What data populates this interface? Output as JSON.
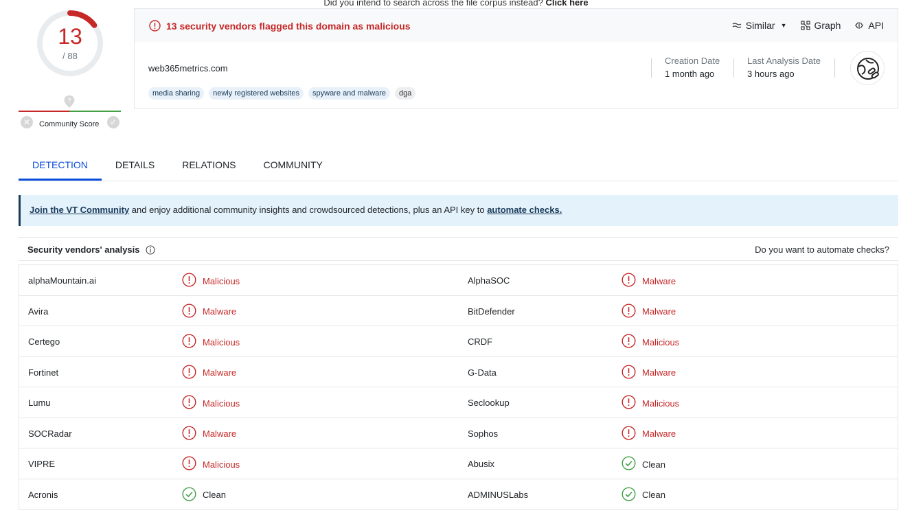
{
  "top_hint": {
    "text": "Did you intend to search across the file corpus instead?",
    "link": "Click here"
  },
  "score": {
    "detections": "13",
    "total": "/ 88",
    "fraction": 0.148,
    "color": "#c62828"
  },
  "community": {
    "label": "Community Score"
  },
  "alert": {
    "text": "13 security vendors flagged this domain as malicious"
  },
  "actions": {
    "similar": "Similar",
    "graph": "Graph",
    "api": "API"
  },
  "domain": "web365metrics.com",
  "tags": [
    "media sharing",
    "newly registered websites",
    "spyware and malware",
    "dga"
  ],
  "meta": [
    {
      "label": "Creation Date",
      "value": "1 month ago"
    },
    {
      "label": "Last Analysis Date",
      "value": "3 hours ago"
    }
  ],
  "tabs": [
    {
      "label": "DETECTION",
      "active": true
    },
    {
      "label": "DETAILS",
      "active": false
    },
    {
      "label": "RELATIONS",
      "active": false
    },
    {
      "label": "COMMUNITY",
      "active": false
    }
  ],
  "banner": {
    "link1": "Join the VT Community",
    "middle": " and enjoy additional community insights and crowdsourced detections, plus an API key to ",
    "link2": "automate checks."
  },
  "analysis": {
    "title": "Security vendors' analysis",
    "right": "Do you want to automate checks?"
  },
  "vendors": [
    [
      {
        "name": "alphaMountain.ai",
        "result": "Malicious",
        "status": "bad"
      },
      {
        "name": "AlphaSOC",
        "result": "Malware",
        "status": "bad"
      }
    ],
    [
      {
        "name": "Avira",
        "result": "Malware",
        "status": "bad"
      },
      {
        "name": "BitDefender",
        "result": "Malware",
        "status": "bad"
      }
    ],
    [
      {
        "name": "Certego",
        "result": "Malicious",
        "status": "bad"
      },
      {
        "name": "CRDF",
        "result": "Malicious",
        "status": "bad"
      }
    ],
    [
      {
        "name": "Fortinet",
        "result": "Malware",
        "status": "bad"
      },
      {
        "name": "G-Data",
        "result": "Malware",
        "status": "bad"
      }
    ],
    [
      {
        "name": "Lumu",
        "result": "Malicious",
        "status": "bad"
      },
      {
        "name": "Seclookup",
        "result": "Malicious",
        "status": "bad"
      }
    ],
    [
      {
        "name": "SOCRadar",
        "result": "Malware",
        "status": "bad"
      },
      {
        "name": "Sophos",
        "result": "Malware",
        "status": "bad"
      }
    ],
    [
      {
        "name": "VIPRE",
        "result": "Malicious",
        "status": "bad"
      },
      {
        "name": "Abusix",
        "result": "Clean",
        "status": "ok"
      }
    ],
    [
      {
        "name": "Acronis",
        "result": "Clean",
        "status": "ok"
      },
      {
        "name": "ADMINUSLabs",
        "result": "Clean",
        "status": "ok"
      }
    ]
  ],
  "colors": {
    "malicious": "#c62828",
    "clean": "#43a047",
    "accent": "#0b4dda"
  }
}
